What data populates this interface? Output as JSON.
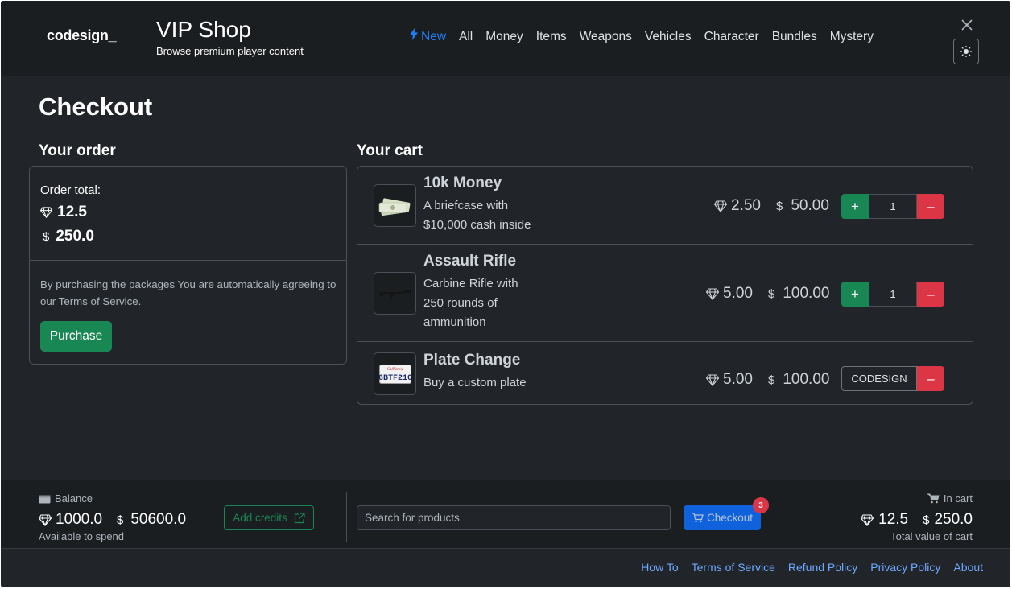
{
  "header": {
    "logo": "codesign_",
    "title": "VIP Shop",
    "subtitle": "Browse premium player content",
    "nav": [
      {
        "label": "New",
        "active": true
      },
      {
        "label": "All"
      },
      {
        "label": "Money"
      },
      {
        "label": "Items"
      },
      {
        "label": "Weapons"
      },
      {
        "label": "Vehicles"
      },
      {
        "label": "Character"
      },
      {
        "label": "Bundles"
      },
      {
        "label": "Mystery"
      }
    ]
  },
  "main": {
    "title": "Checkout",
    "order": {
      "heading": "Your order",
      "total_label": "Order total:",
      "gem_total": "12.5",
      "usd_total": "250.0",
      "terms_text": "By purchasing the packages You are automatically agreeing to our Terms of Service.",
      "purchase_label": "Purchase"
    },
    "cart": {
      "heading": "Your cart",
      "items": [
        {
          "name": "10k Money",
          "description": "A briefcase with $10,000 cash inside",
          "gem_price": "2.50",
          "usd_price": "50.00",
          "quantity": "1",
          "thumb": "money-stack-icon"
        },
        {
          "name": "Assault Rifle",
          "description": "Carbine Rifle with 250 rounds of ammunition",
          "gem_price": "5.00",
          "usd_price": "100.00",
          "quantity": "1",
          "thumb": "rifle-icon"
        },
        {
          "name": "Plate Change",
          "description": "Buy a custom plate",
          "gem_price": "5.00",
          "usd_price": "100.00",
          "plate_value": "CODESIGN",
          "thumb": "license-plate-icon",
          "plate_text": "6BTF210"
        }
      ]
    }
  },
  "bottom": {
    "balance_label": "Balance",
    "balance_gem": "1000.0",
    "balance_usd": "50600.0",
    "balance_sub": "Available to spend",
    "add_credits_label": "Add credits",
    "search_placeholder": "Search for products",
    "checkout_label": "Checkout",
    "checkout_badge": "3",
    "incart_label": "In cart",
    "incart_gem": "12.5",
    "incart_usd": "250.0",
    "incart_sub": "Total value of cart"
  },
  "footer": {
    "links": [
      "How To",
      "Terms of Service",
      "Refund Policy",
      "Privacy Policy",
      "About"
    ]
  },
  "symbols": {
    "usd": "$",
    "plus": "+",
    "minus": "–"
  },
  "colors": {
    "accent_blue": "#0d6efd",
    "active_nav": "#1f7ff5",
    "success": "#198754",
    "danger": "#dc3545",
    "background": "#212529",
    "header_bg": "#1b1e21"
  }
}
